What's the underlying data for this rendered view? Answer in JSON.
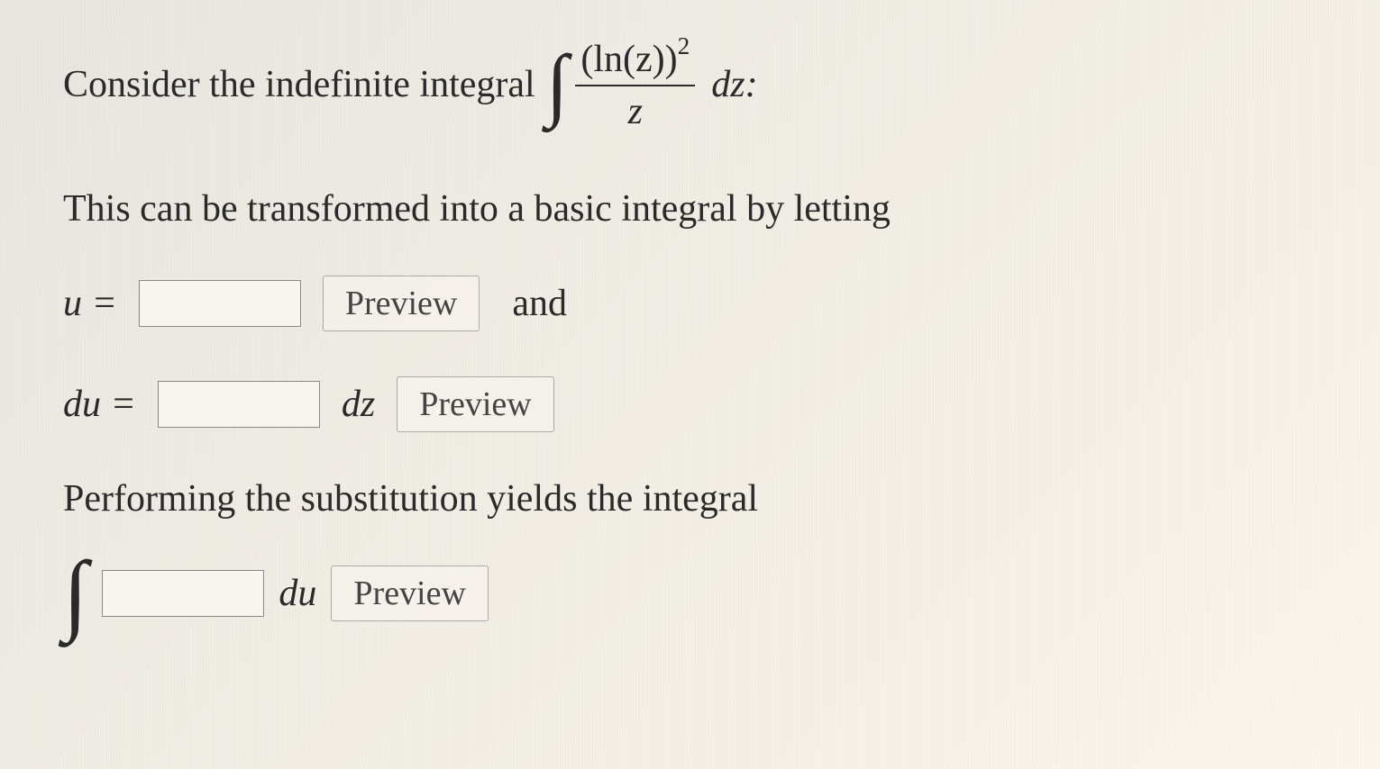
{
  "problem": {
    "intro_text": "Consider the indefinite integral",
    "integrand_numerator": "(ln(z))",
    "integrand_exponent": "2",
    "integrand_denominator": "z",
    "differential1": "dz:",
    "transform_text": "This can be transformed into a basic integral by letting",
    "u_label": "u =",
    "preview_label": "Preview",
    "and_text": "and",
    "du_label": "du =",
    "dz_suffix": "dz",
    "substitution_text": "Performing the substitution yields the integral",
    "du_suffix": "du"
  },
  "inputs": {
    "u_value": "",
    "du_value": "",
    "integrand_value": ""
  }
}
